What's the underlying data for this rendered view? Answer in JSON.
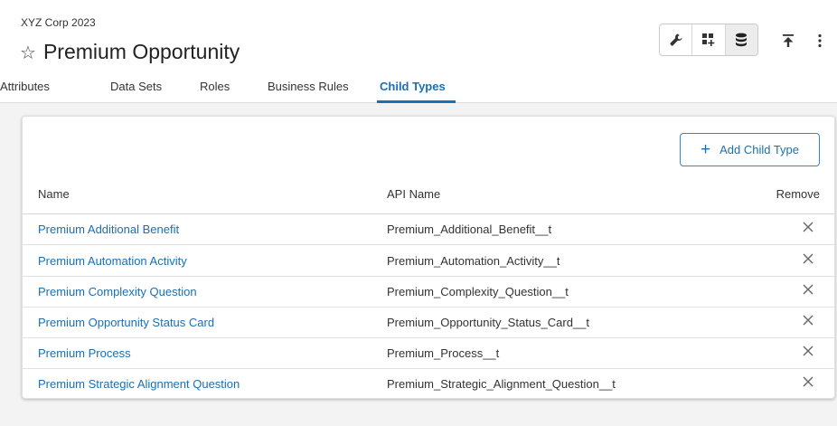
{
  "header": {
    "org": "XYZ Corp 2023",
    "title": "Premium Opportunity",
    "star_icon": "star-outline-icon",
    "tools": [
      {
        "icon": "wrench-icon"
      },
      {
        "icon": "grid-add-icon"
      },
      {
        "icon": "database-icon",
        "selected": true
      }
    ],
    "upload_icon": "upload-to-top-icon",
    "more_icon": "more-vertical-icon"
  },
  "tabs": [
    {
      "label": "Attributes",
      "active": false
    },
    {
      "label": "Data Sets",
      "active": false
    },
    {
      "label": "Roles",
      "active": false
    },
    {
      "label": "Business Rules",
      "active": false
    },
    {
      "label": "Child Types",
      "active": true
    }
  ],
  "card": {
    "add_button": {
      "label": "Add Child Type",
      "icon": "plus-icon"
    },
    "columns": {
      "name": "Name",
      "api": "API Name",
      "remove": "Remove"
    },
    "rows": [
      {
        "name": "Premium Additional Benefit",
        "api": "Premium_Additional_Benefit__t"
      },
      {
        "name": "Premium Automation Activity",
        "api": "Premium_Automation_Activity__t"
      },
      {
        "name": "Premium Complexity Question",
        "api": "Premium_Complexity_Question__t"
      },
      {
        "name": "Premium Opportunity Status Card",
        "api": "Premium_Opportunity_Status_Card__t"
      },
      {
        "name": "Premium Process",
        "api": "Premium_Process__t"
      },
      {
        "name": "Premium Strategic Alignment Question",
        "api": "Premium_Strategic_Alignment_Question__t"
      }
    ]
  },
  "colors": {
    "accent": "#1a6fb5",
    "background": "#f3f3f4"
  }
}
